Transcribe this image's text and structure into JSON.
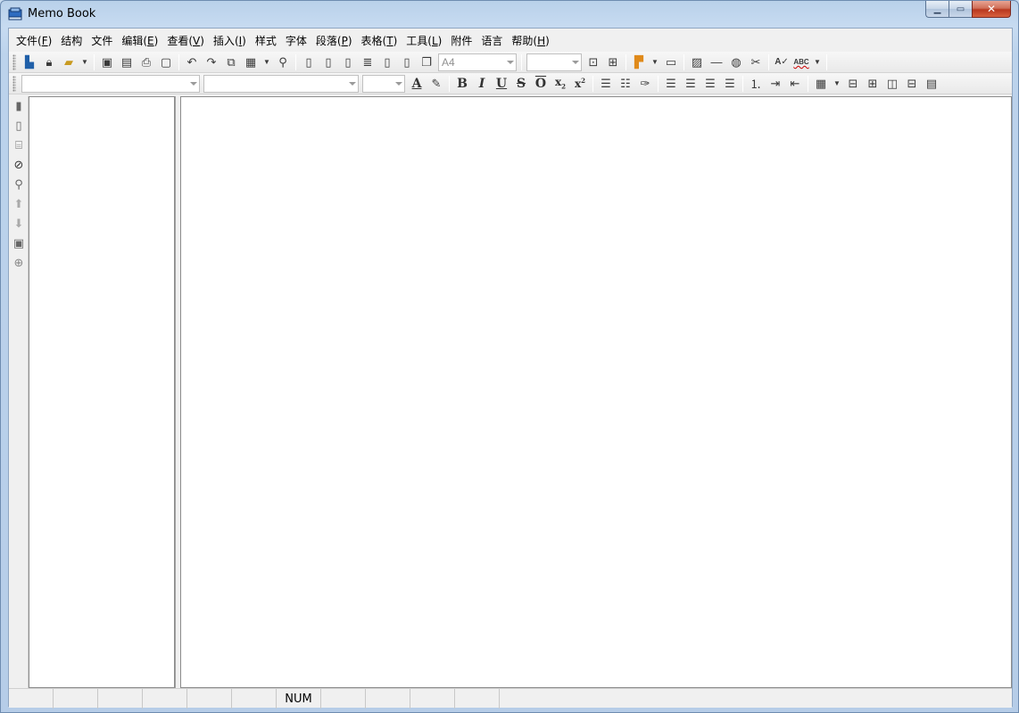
{
  "window": {
    "title": "Memo Book"
  },
  "menu": {
    "items": [
      {
        "label": "文件",
        "key": "F"
      },
      {
        "label": "结构",
        "key": ""
      },
      {
        "label": "文件",
        "key": ""
      },
      {
        "label": "编辑",
        "key": "E"
      },
      {
        "label": "查看",
        "key": "V"
      },
      {
        "label": "插入",
        "key": "I"
      },
      {
        "label": "样式",
        "key": ""
      },
      {
        "label": "字体",
        "key": ""
      },
      {
        "label": "段落",
        "key": "P"
      },
      {
        "label": "表格",
        "key": "T"
      },
      {
        "label": "工具",
        "key": "L"
      },
      {
        "label": "附件",
        "key": ""
      },
      {
        "label": "语言",
        "key": ""
      },
      {
        "label": "帮助",
        "key": "H"
      }
    ]
  },
  "toolbar": {
    "page_size": "A4",
    "zoom": "",
    "font_name": "",
    "style_name": "",
    "font_size": ""
  },
  "icons": {
    "accent": "#1f5fa8"
  },
  "statusbar": {
    "cells": [
      "",
      "",
      "",
      "",
      "",
      "",
      "NUM",
      "",
      "",
      "",
      ""
    ]
  }
}
